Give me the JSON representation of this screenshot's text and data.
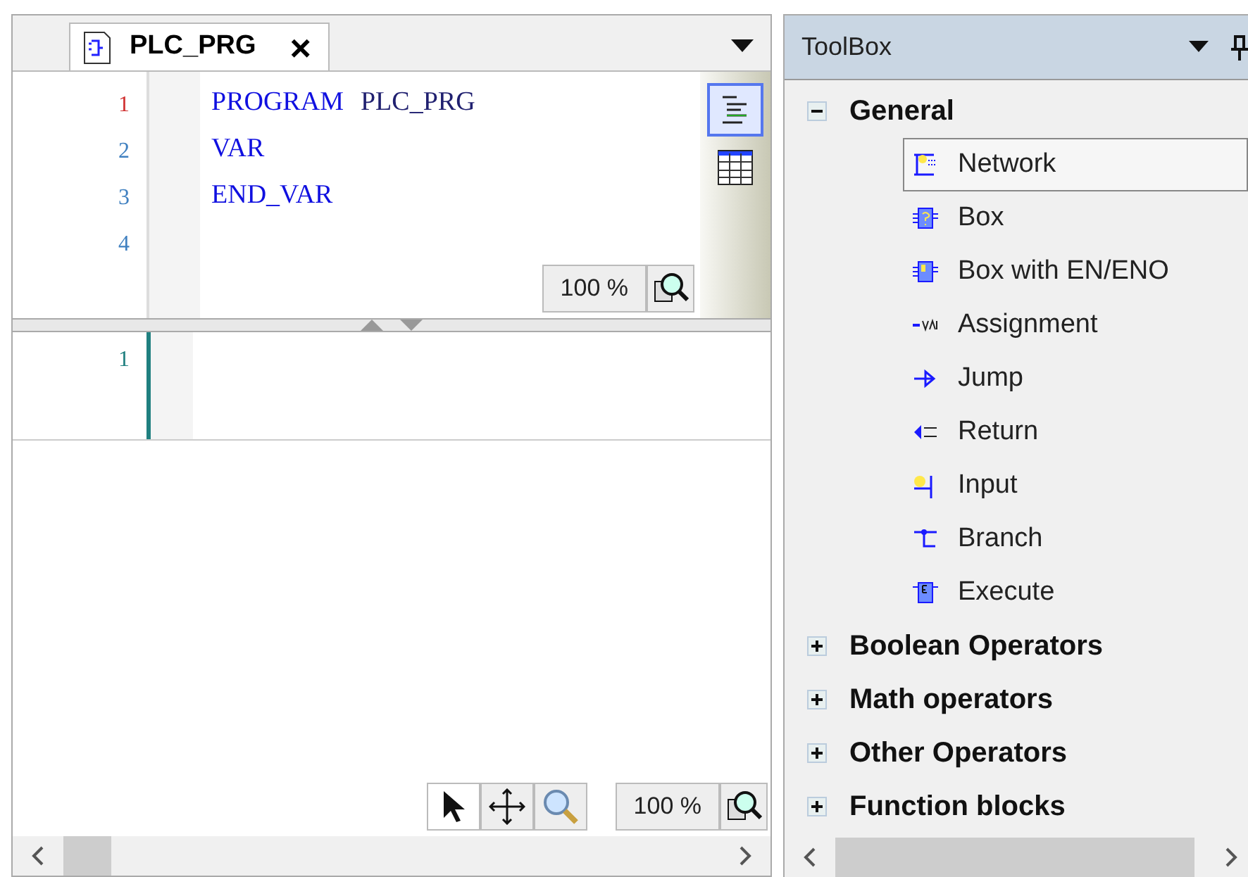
{
  "editor": {
    "tab": {
      "label": "PLC_PRG",
      "close": "×"
    },
    "declaration_lines": [
      {
        "number": "1",
        "current": true,
        "tokens": [
          {
            "text": "PROGRAM",
            "kind": "keyword"
          },
          {
            "text": "PLC_PRG",
            "kind": "identifier"
          }
        ]
      },
      {
        "number": "2",
        "current": false,
        "tokens": [
          {
            "text": "VAR",
            "kind": "keyword"
          }
        ]
      },
      {
        "number": "3",
        "current": false,
        "tokens": [
          {
            "text": "END_VAR",
            "kind": "keyword"
          }
        ]
      },
      {
        "number": "4",
        "current": false
      }
    ],
    "declaration_zoom": "100 %",
    "body_lines": [
      {
        "number": "1"
      }
    ],
    "body_zoom": "100 %"
  },
  "toolbox": {
    "title": "ToolBox",
    "groups": [
      {
        "label": "General",
        "expanded": true,
        "items": [
          {
            "label": "Network",
            "kind": "network",
            "selected": true
          },
          {
            "label": "Box",
            "kind": "box",
            "selected": false
          },
          {
            "label": "Box with EN/ENO",
            "kind": "box-en",
            "selected": false
          },
          {
            "label": "Assignment",
            "kind": "assignment",
            "selected": false
          },
          {
            "label": "Jump",
            "kind": "jump",
            "selected": false
          },
          {
            "label": "Return",
            "kind": "return",
            "selected": false
          },
          {
            "label": "Input",
            "kind": "input",
            "selected": false
          },
          {
            "label": "Branch",
            "kind": "branch",
            "selected": false
          },
          {
            "label": "Execute",
            "kind": "execute",
            "selected": false
          }
        ]
      },
      {
        "label": "Boolean Operators",
        "expanded": false
      },
      {
        "label": "Math operators",
        "expanded": false
      },
      {
        "label": "Other Operators",
        "expanded": false
      },
      {
        "label": "Function blocks",
        "expanded": false
      }
    ]
  }
}
